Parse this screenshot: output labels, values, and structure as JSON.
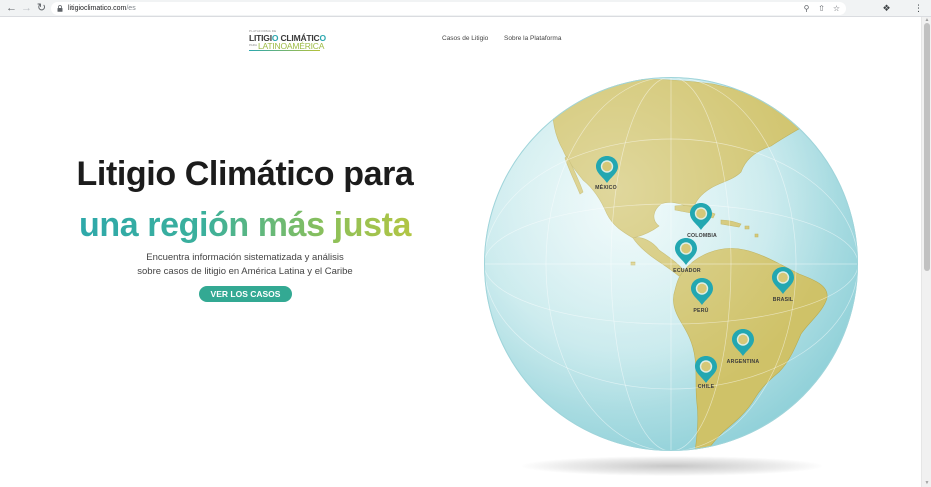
{
  "browser": {
    "url_host": "litigioclimatico.com",
    "url_path": "/es",
    "back_icon": "arrow-left-icon",
    "forward_icon": "arrow-right-icon",
    "reload_icon": "reload-icon",
    "lock_icon": "lock-icon",
    "zoom_icon": "magnifier-icon",
    "share_icon": "share-icon",
    "bookmark_icon": "star-icon",
    "extensions_icon": "puzzle-icon",
    "menu_icon": "kebab-menu-icon"
  },
  "site": {
    "logo": {
      "line1": "PLATAFORMA DE",
      "main_a": "LITIGI",
      "main_o1": "O",
      "main_b": " CLIMÁTIC",
      "main_o2": "O",
      "line3_small": "PARA",
      "line3": "LATINOAMÉRICA"
    },
    "nav": [
      {
        "label": "Casos de Litigio"
      },
      {
        "label": "Sobre la Plataforma"
      }
    ]
  },
  "hero": {
    "title_line1": "Litigio Climático para",
    "title_line2": "una región más justa",
    "description_line1": "Encuentra información sistematizada y análisis",
    "description_line2": "sobre casos de litigio en América Latina y el Caribe",
    "cta_label": "VER LOS CASOS"
  },
  "map": {
    "colors": {
      "ocean": "#bfe6ea",
      "land": "#cfc268",
      "pin": "#23a7b1"
    },
    "pins": [
      {
        "label": "MÉXICO"
      },
      {
        "label": "COLOMBIA"
      },
      {
        "label": "ECUADOR"
      },
      {
        "label": "BRASIL"
      },
      {
        "label": "PERÚ"
      },
      {
        "label": "ARGENTINA"
      },
      {
        "label": "CHILE"
      }
    ]
  }
}
